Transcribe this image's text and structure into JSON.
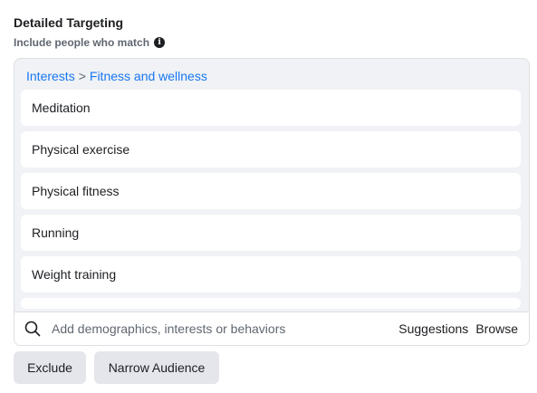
{
  "section": {
    "title": "Detailed Targeting",
    "subtitle": "Include people who match"
  },
  "breadcrumb": {
    "parent": "Interests",
    "separator": ">",
    "current": "Fitness and wellness"
  },
  "items": [
    "Meditation",
    "Physical exercise",
    "Physical fitness",
    "Running",
    "Weight training"
  ],
  "search": {
    "placeholder": "Add demographics, interests or behaviors",
    "suggestions_label": "Suggestions",
    "browse_label": "Browse"
  },
  "actions": {
    "exclude_label": "Exclude",
    "narrow_label": "Narrow Audience"
  },
  "colors": {
    "link": "#1877f2",
    "panel_bg": "#f0f2f5",
    "button_bg": "#e4e6eb"
  }
}
